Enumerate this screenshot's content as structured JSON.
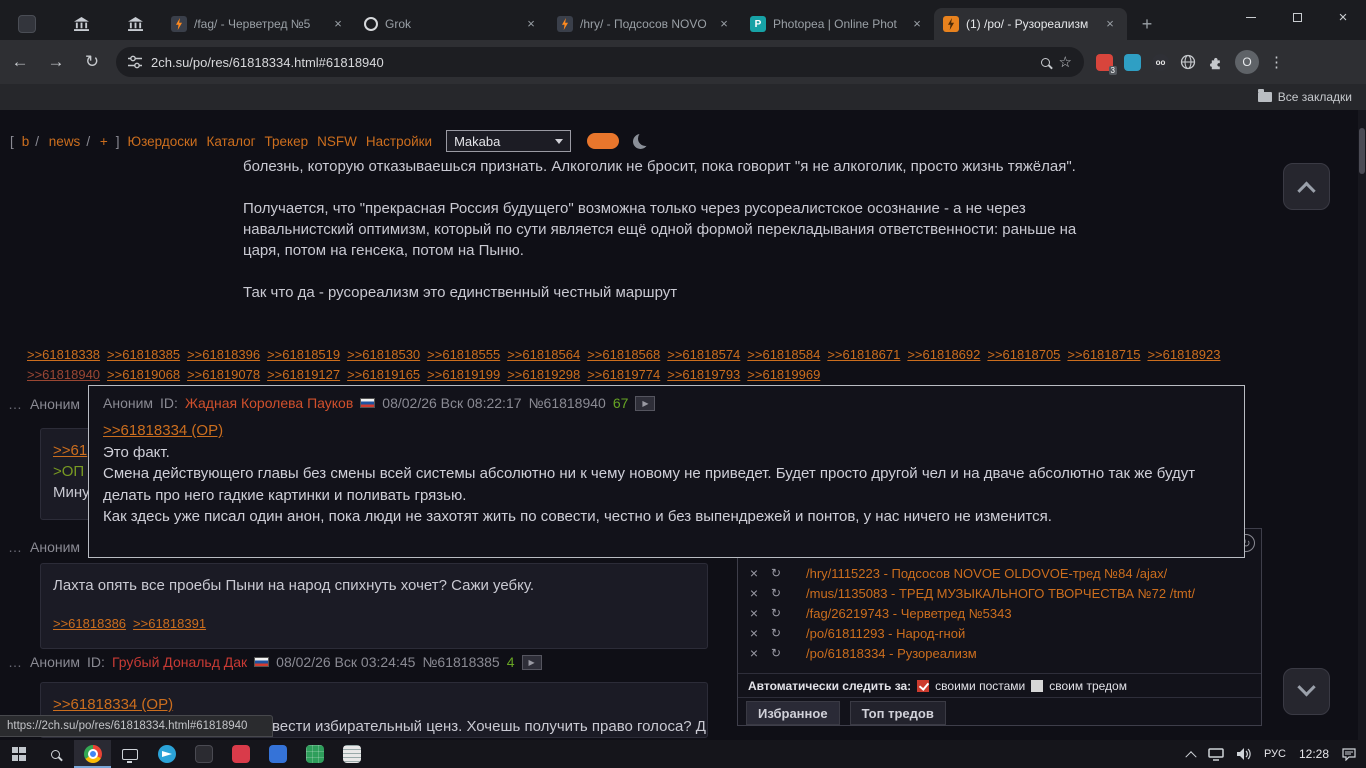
{
  "colors": {
    "accent_orange": "#cc6e1e",
    "greentext": "#789922",
    "id_red": "#c83a34",
    "id_orange": "#d0502c",
    "count_green": "#67a524",
    "checkbox_red": "#cc3b2e"
  },
  "browser": {
    "tabs": [
      {
        "title": "/fag/ - Черветред №5"
      },
      {
        "title": "Grok"
      },
      {
        "title": "/hry/ - Подсосов NOVO"
      },
      {
        "title": "Photopea | Online Phot"
      },
      {
        "title": "(1) /po/ - Рузореализм"
      }
    ],
    "photopea_glyph": "P",
    "url": "2ch.su/po/res/61818334.html#61818940",
    "extension_badge": "3",
    "extension_oo": "oo",
    "profile_initial": "O",
    "bookmarks_label": "Все закладки"
  },
  "site_nav": {
    "bracket_left": "[",
    "bracket_right": "]",
    "boards": [
      "b",
      "news",
      "+"
    ],
    "links": [
      "Юзердоски",
      "Каталог",
      "Трекер",
      "NSFW",
      "Настройки"
    ],
    "style_value": "Makaba"
  },
  "op_post": {
    "paragraphs": [
      "болезнь, которую отказываешься признать. Алкоголик не бросит, пока говорит \"я не алкоголик, просто жизнь тяжёлая\".",
      "Получается, что \"прекрасная Россия будущего\" возможна только через русореалистское осознание - а не через навальнистский оптимизм, который по сути является ещё одной формой перекладывания ответственности: раньше на царя, потом на генсека, потом на Пыню.",
      "Так что да - русореализм это единственный честный маршрут"
    ],
    "replies_row1": [
      ">>61818338",
      ">>61818385",
      ">>61818396",
      ">>61818519",
      ">>61818530",
      ">>61818555",
      ">>61818564",
      ">>61818568",
      ">>61818574",
      ">>61818584",
      ">>61818671",
      ">>61818692",
      ">>61818705",
      ">>61818715",
      ">>61818923"
    ],
    "replies_row2": [
      ">>61818940",
      ">>61819068",
      ">>61819078",
      ">>61819127",
      ">>61819165",
      ">>61819199",
      ">>61819298",
      ">>61819774",
      ">>61819793",
      ">>61819969"
    ]
  },
  "popup_post": {
    "name": "Аноним",
    "id_label": "ID:",
    "id_name": "Жадная Королева Пауков",
    "date": "08/02/26 Вск 08:22:17",
    "number": "№61818940",
    "reply_count": "67",
    "op_link": ">>61818334 (OP)",
    "lines": [
      "Это факт.",
      "Смена действующего главы без смены всей системы абсолютно ни к чему новому не приведет. Будет просто другой чел и на дваче абсолютно так же будут делать про него гадкие картинки и поливать грязью.",
      "Как здесь уже писал один анон, пока люди не захотят жить по совести, честно и без выпендрежей и понтов, у нас ничего не изменится."
    ]
  },
  "post_a": {
    "name": "Аноним",
    "link_fragment": ">>61",
    "green_fragment": ">ОП",
    "text_fragment": "Мину"
  },
  "post_b": {
    "name": "Аноним",
    "text": "Лахта опять все проебы Пыни на народ спихнуть хочет? Сажи уебку.",
    "replies": [
      ">>61818386",
      ">>61818391"
    ]
  },
  "post_c": {
    "name": "Аноним",
    "id_label": "ID:",
    "id_name": "Грубый Дональд Дак",
    "date": "08/02/26 Вск 03:24:45",
    "number": "№61818385",
    "reply_count": "4",
    "op_link": ">>61818334 (OP)",
    "text_fragment": "вести избирательный ценз. Хочешь получить право голоса? Д"
  },
  "sidebar": {
    "threads": [
      "/hry/1115223 - Подсосов NOVOE OLDOVOE-тред №84 /ajax/",
      "/mus/1135083 - ТРЕД МУЗЫКАЛЬНОГО ТВОРЧЕСТВА №72 /tmt/",
      "/fag/26219743 - Черветред №5343",
      "/po/61811293 - Народ-гной",
      "/po/61818334 - Рузореализм"
    ],
    "watch_label": "Автоматически следить за:",
    "watch_posts": "своими постами",
    "watch_thread": "своим тредом",
    "tab_favorites": "Избранное",
    "tab_top": "Топ тредов"
  },
  "status_bar": {
    "url": "https://2ch.su/po/res/61818334.html#61818940"
  },
  "taskbar": {
    "lang": "РУС",
    "time": "12:28"
  }
}
